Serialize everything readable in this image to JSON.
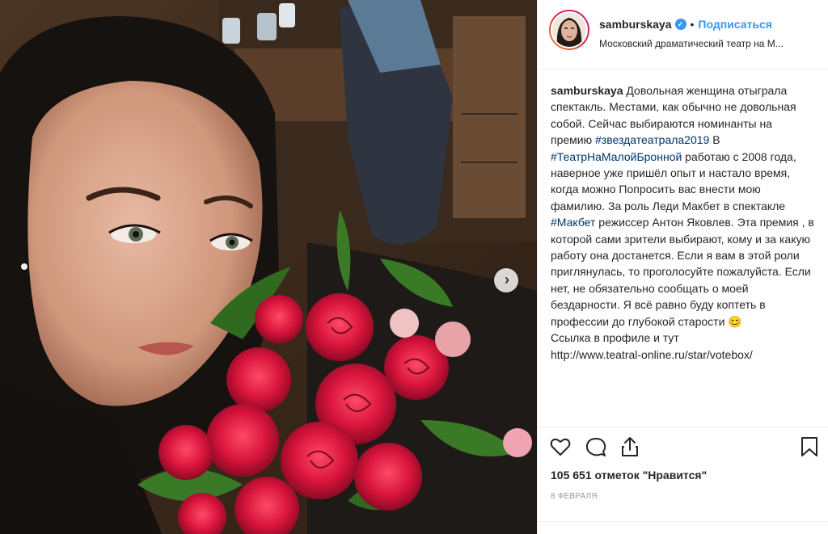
{
  "post": {
    "username": "samburskaya",
    "verified_badge": "✓",
    "separator": "•",
    "follow_label": "Подписаться",
    "location": "Московский драматический театр на М..."
  },
  "caption": {
    "username": "samburskaya",
    "text_1": "Довольная женщина отыграла спектакль. Местами, как обычно не довольная собой. Сейчас выбираются номинанты на премию ",
    "hashtag_1": "#звездатеатрала2019",
    "text_2": " В ",
    "hashtag_2": "#ТеатрНаМалойБронной",
    "text_3": " работаю с 2008 года, наверное уже пришёл опыт и настало время, когда можно Попросить вас внести мою фамилию. За роль Леди Макбет в спектакле ",
    "hashtag_3": "#Макбет",
    "text_4": " режиссер Антон Яковлев. Эта премия , в которой сами зрители выбирают, кому и за какую работу она достанется. Если я вам в этой роли приглянулась, то проголосуйте пожалуйста. Если нет, не обязательно сообщать о моей бездарности. Я всё равно буду коптеть в профессии до глубокой старости 😊",
    "text_5": "Ссылка в профиле и тут",
    "link": "http://www.teatral-online.ru/star/votebox/"
  },
  "actions": {
    "like_icon": "heart-icon",
    "comment_icon": "comment-icon",
    "share_icon": "share-icon",
    "save_icon": "bookmark-icon",
    "likes_text": "105 651 отметок \"Нравится\"",
    "date_text": "8 ФЕВРАЛЯ"
  },
  "carousel": {
    "next_icon": "›"
  },
  "colors": {
    "accent": "#3897f0",
    "hashtag": "#003569",
    "muted": "#999999"
  }
}
